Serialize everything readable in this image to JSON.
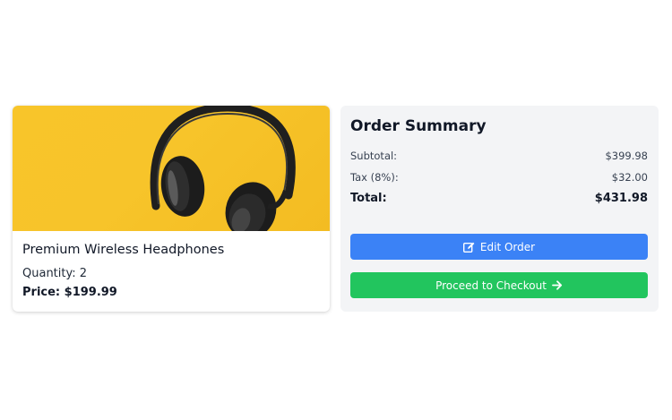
{
  "product": {
    "name": "Premium Wireless Headphones",
    "quantity_text": "Quantity: 2",
    "price_text": "Price: $199.99"
  },
  "summary": {
    "title": "Order Summary",
    "subtotal_label": "Subtotal:",
    "subtotal_value": "$399.98",
    "tax_label": "Tax (8%):",
    "tax_value": "$32.00",
    "total_label": "Total:",
    "total_value": "$431.98"
  },
  "actions": {
    "edit_label": "Edit Order",
    "edit_icon": "edit-icon",
    "checkout_label": "Proceed to Checkout",
    "checkout_icon": "arrow-right-icon"
  },
  "colors": {
    "edit_button": "#3b82f6",
    "checkout_button": "#22c55e",
    "image_background": "#f8c52a",
    "summary_background": "#f3f4f6"
  }
}
